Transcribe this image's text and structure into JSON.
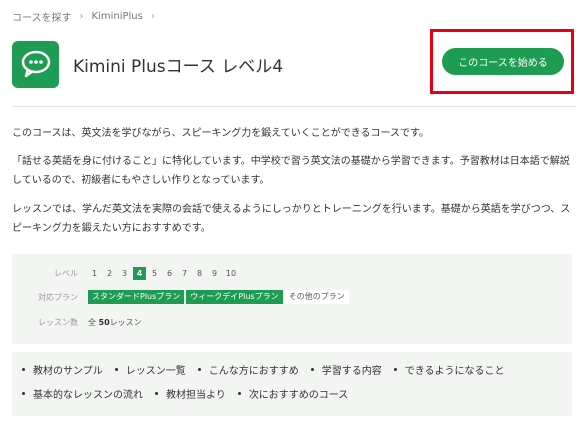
{
  "breadcrumb": {
    "items": [
      "コースを探す",
      "KiminiPlus"
    ]
  },
  "header": {
    "title": "Kimini Plusコース レベル4",
    "cta_label": "このコースを始める"
  },
  "description": {
    "p1": "このコースは、英文法を学びながら、スピーキング力を鍛えていくことができるコースです。",
    "p2": "「話せる英語を身に付けること」に特化しています。中学校で習う英文法の基礎から学習できます。予習教材は日本語で解説しているので、初級者にもやさしい作りとなっています。",
    "p3": "レッスンでは、学んだ英文法を実際の会話で使えるようにしっかりとトレーニングを行います。基礎から英語を学びつつ、スピーキング力を鍛えたい方におすすめです。"
  },
  "meta": {
    "level_label": "レベル",
    "levels": [
      "1",
      "2",
      "3",
      "4",
      "5",
      "6",
      "7",
      "8",
      "9",
      "10"
    ],
    "active_level": "4",
    "plan_label": "対応プラン",
    "plans": [
      "スタンダードPlusプラン",
      "ウィークデイPlusプラン"
    ],
    "plan_other": "その他のプラン",
    "count_label": "レッスン数",
    "count_prefix": "全",
    "count_value": "50",
    "count_suffix": "レッスン"
  },
  "links": {
    "row1": [
      "教材のサンプル",
      "レッスン一覧",
      "こんな方におすすめ",
      "学習する内容",
      "できるようになること"
    ],
    "row2": [
      "基本的なレッスンの流れ",
      "教材担当より",
      "次におすすめのコース"
    ]
  },
  "colors": {
    "accent": "#1f9c54",
    "highlight": "#e60012"
  },
  "icons": {
    "app": "chat-bubble-icon",
    "separator": "chevron-right-icon"
  }
}
